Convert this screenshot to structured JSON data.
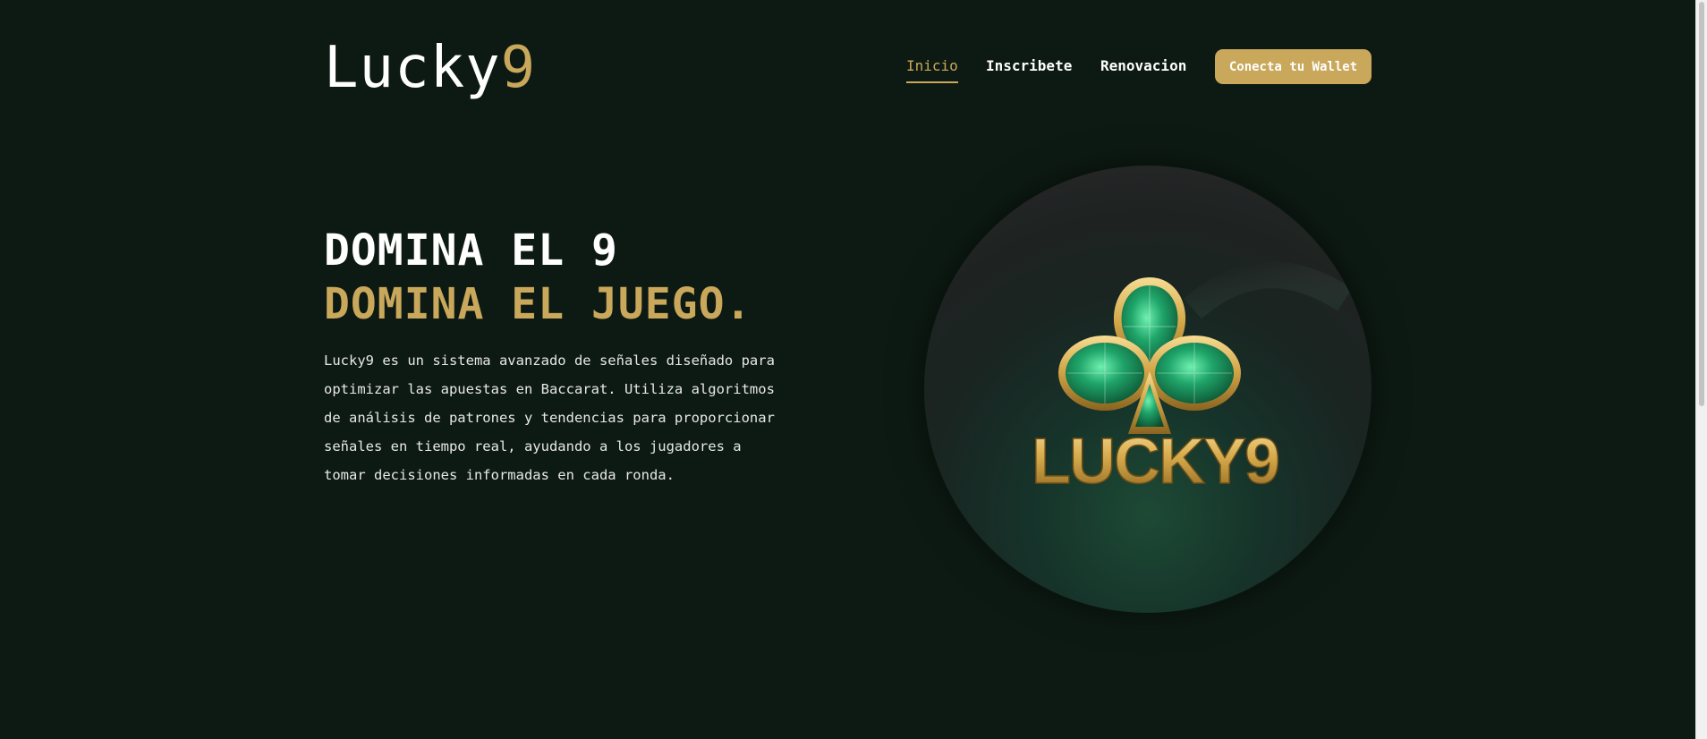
{
  "header": {
    "logo_text": "Lucky",
    "logo_accent": "9"
  },
  "nav": {
    "items": [
      {
        "label": "Inicio",
        "active": true
      },
      {
        "label": "Inscribete",
        "active": false
      },
      {
        "label": "Renovacion",
        "active": false
      }
    ],
    "wallet_button": "Conecta tu Wallet"
  },
  "hero": {
    "headline_line1": "DOMINA EL 9",
    "headline_line2": "DOMINA EL JUEGO.",
    "description": "Lucky9 es un sistema avanzado de señales diseñado para optimizar las apuestas en Baccarat. Utiliza algoritmos de análisis de patrones y tendencias para proporcionar señales en tiempo real, ayudando a los jugadores a tomar decisiones informadas en cada ronda.",
    "image_text": "LUCKY9",
    "image_icon": "emerald-club-icon"
  },
  "colors": {
    "background": "#0d1a13",
    "accent": "#c9a85b",
    "emerald": "#1fa56a"
  }
}
